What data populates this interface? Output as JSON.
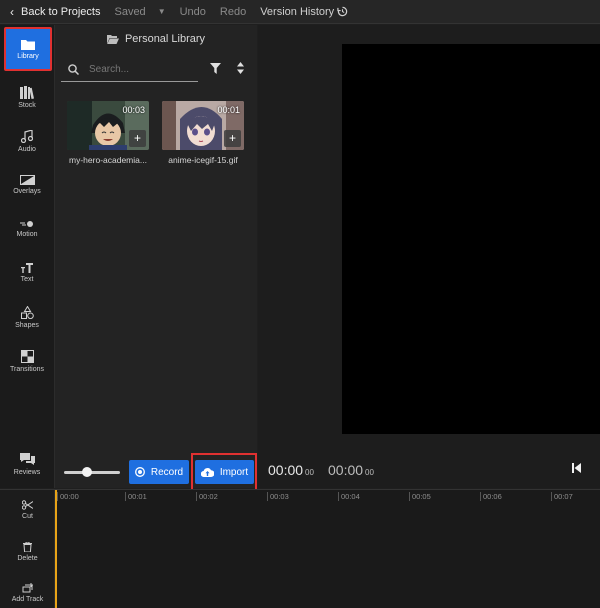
{
  "topbar": {
    "back_label": "Back to Projects",
    "saved_label": "Saved",
    "undo_label": "Undo",
    "redo_label": "Redo",
    "version_history_label": "Version History"
  },
  "rail": {
    "items": [
      {
        "label": "Library",
        "icon": "folder-icon",
        "active": true
      },
      {
        "label": "Stock",
        "icon": "books-icon"
      },
      {
        "label": "Audio",
        "icon": "music-note-icon"
      },
      {
        "label": "Overlays",
        "icon": "overlay-icon"
      },
      {
        "label": "Motion",
        "icon": "motion-icon"
      },
      {
        "label": "Text",
        "icon": "text-icon"
      },
      {
        "label": "Shapes",
        "icon": "shapes-icon"
      },
      {
        "label": "Transitions",
        "icon": "transitions-icon"
      },
      {
        "label": "Reviews",
        "icon": "chat-icon"
      }
    ]
  },
  "library": {
    "title": "Personal Library",
    "search_placeholder": "Search...",
    "items": [
      {
        "name": "my-hero-academia...",
        "duration": "00:03"
      },
      {
        "name": "anime-icegif-15.gif",
        "duration": "00:01"
      }
    ]
  },
  "controls": {
    "record_label": "Record",
    "import_label": "Import",
    "zoom_level": 0.4
  },
  "preview": {
    "current_time": "00:00",
    "current_frames": "00",
    "total_time": "00:00",
    "total_frames": "00"
  },
  "timeline": {
    "tools": [
      {
        "label": "Cut",
        "icon": "scissors-icon"
      },
      {
        "label": "Delete",
        "icon": "trash-icon"
      },
      {
        "label": "Add Track",
        "icon": "add-track-icon"
      }
    ],
    "ticks": [
      "00:00",
      "00:01",
      "00:02",
      "00:03",
      "00:04",
      "00:05",
      "00:06",
      "00:07"
    ]
  },
  "colors": {
    "accent": "#1f6fe0",
    "highlight": "#e03131",
    "playhead": "#e8a317"
  }
}
